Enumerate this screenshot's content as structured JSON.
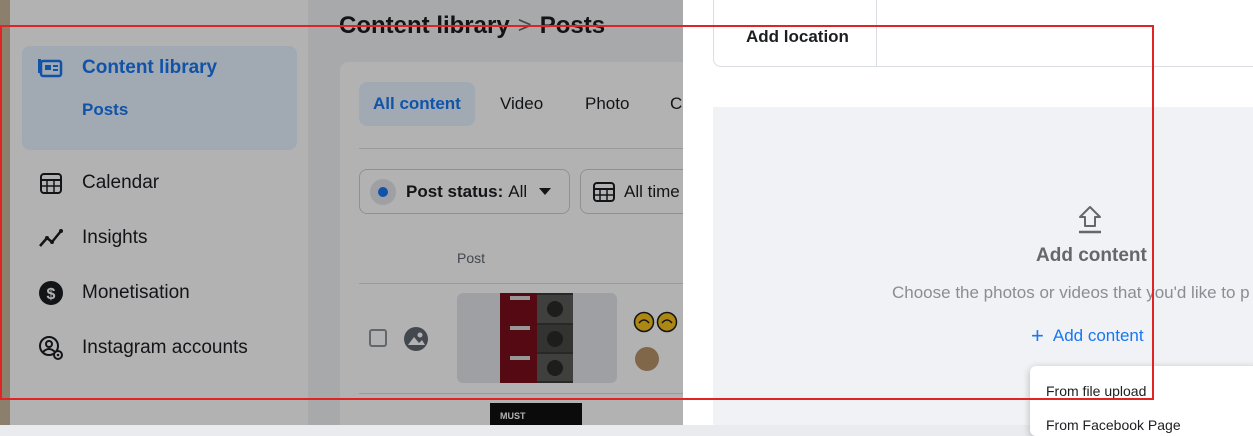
{
  "sidebar": {
    "items": [
      {
        "label": "Content library",
        "icon": "content-library-icon",
        "active": true
      },
      {
        "label": "Calendar",
        "icon": "calendar-icon"
      },
      {
        "label": "Insights",
        "icon": "insights-icon"
      },
      {
        "label": "Monetisation",
        "icon": "dollar-icon"
      },
      {
        "label": "Instagram accounts",
        "icon": "instagram-accounts-icon"
      }
    ],
    "sub_item": "Posts"
  },
  "breadcrumb": {
    "root": "Content library",
    "separator": ">",
    "current": "Posts"
  },
  "tabs": [
    "All content",
    "Video",
    "Photo",
    "C"
  ],
  "filters": {
    "status_label": "Post status:",
    "status_value": "All",
    "time_label": "All time"
  },
  "table": {
    "column_post": "Post"
  },
  "row_preview": {
    "thumb_text": "MUST"
  },
  "location": {
    "label": "Add location"
  },
  "upload": {
    "title": "Add content",
    "subtitle": "Choose the photos or videos that you'd like to p",
    "link": "Add content"
  },
  "dropdown": {
    "items": [
      "From file upload",
      "From Facebook Page"
    ]
  },
  "colors": {
    "accent": "#1877f2",
    "highlight_box": "#e02424",
    "active_bg": "#e7f3ff"
  }
}
